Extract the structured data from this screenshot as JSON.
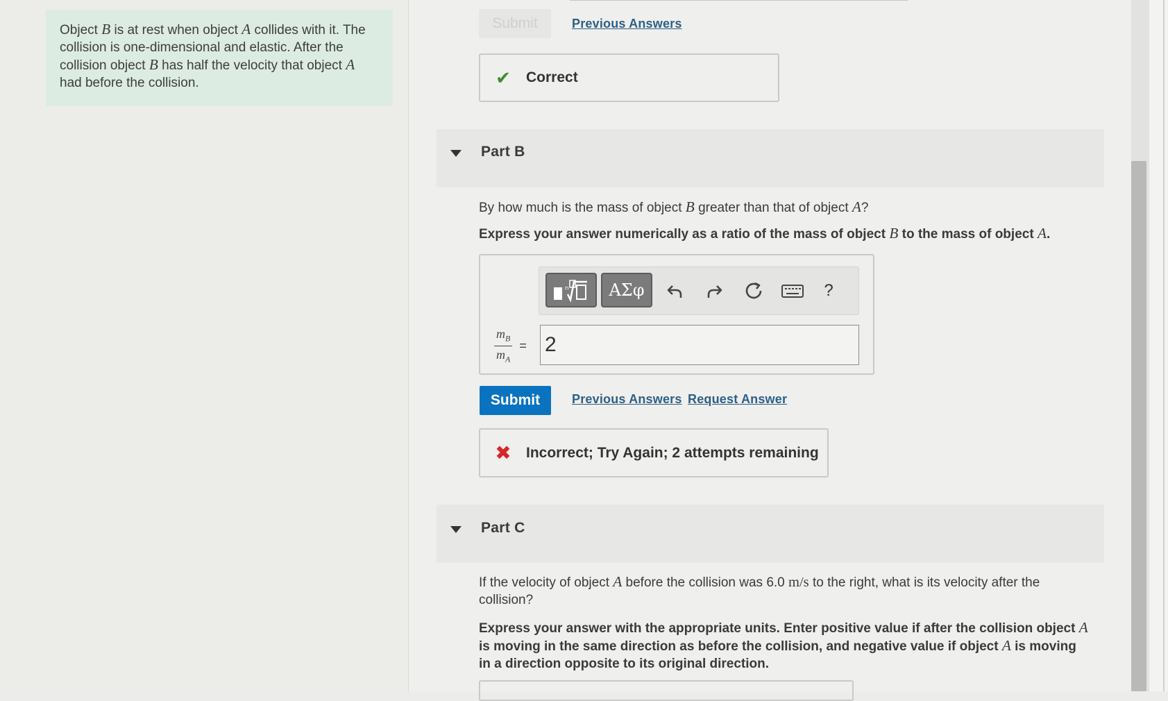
{
  "problem": {
    "t1": "Object ",
    "vB1": "B",
    "t2": " is at rest when object ",
    "vA1": "A",
    "t3": " collides with it. The collision is one-dimensional and elastic. After the collision object ",
    "vB2": "B",
    "t4": " has half the velocity that object ",
    "vA2": "A",
    "t5": " had before the collision."
  },
  "part_a": {
    "submit_label": "Submit",
    "previous_answers": "Previous Answers",
    "feedback": "Correct"
  },
  "part_b": {
    "title": "Part B",
    "q_pre": "By how much is the mass of object ",
    "q_var1": "B",
    "q_mid": " greater than that of object ",
    "q_var2": "A",
    "q_end": "?",
    "ins_pre": "Express your answer numerically as a ratio of the mass of object ",
    "ins_var1": "B",
    "ins_mid": " to the mass of object ",
    "ins_var2": "A",
    "ins_end": ".",
    "toolbar": {
      "symbols_label": "ΑΣφ",
      "help_label": "?"
    },
    "lhs": {
      "num_var": "m",
      "num_sub": "B",
      "den_var": "m",
      "den_sub": "A",
      "equals": "="
    },
    "answer_value": "2",
    "submit_label": "Submit",
    "previous_answers": "Previous Answers",
    "request_answer": "Request Answer",
    "feedback": "Incorrect; Try Again; 2 attempts remaining"
  },
  "part_c": {
    "title": "Part C",
    "q_pre": "If the velocity of object ",
    "q_var": "A",
    "q_mid": " before the collision was 6.0 ",
    "q_unit": "m/s",
    "q_end": " to the right, what is its velocity after the collision?",
    "ins_pre": "Express your answer with the appropriate units. Enter positive value if after the collision object ",
    "ins_var1": "A",
    "ins_mid": " is moving in the same direction as before the collision, and negative value if object ",
    "ins_var2": "A",
    "ins_end": " is moving in a direction opposite to its original direction."
  },
  "colors": {
    "problem_bg": "#dcece2",
    "submit_blue": "#0a73bf",
    "correct_green": "#3f8c2f",
    "incorrect_red": "#d7262a"
  }
}
